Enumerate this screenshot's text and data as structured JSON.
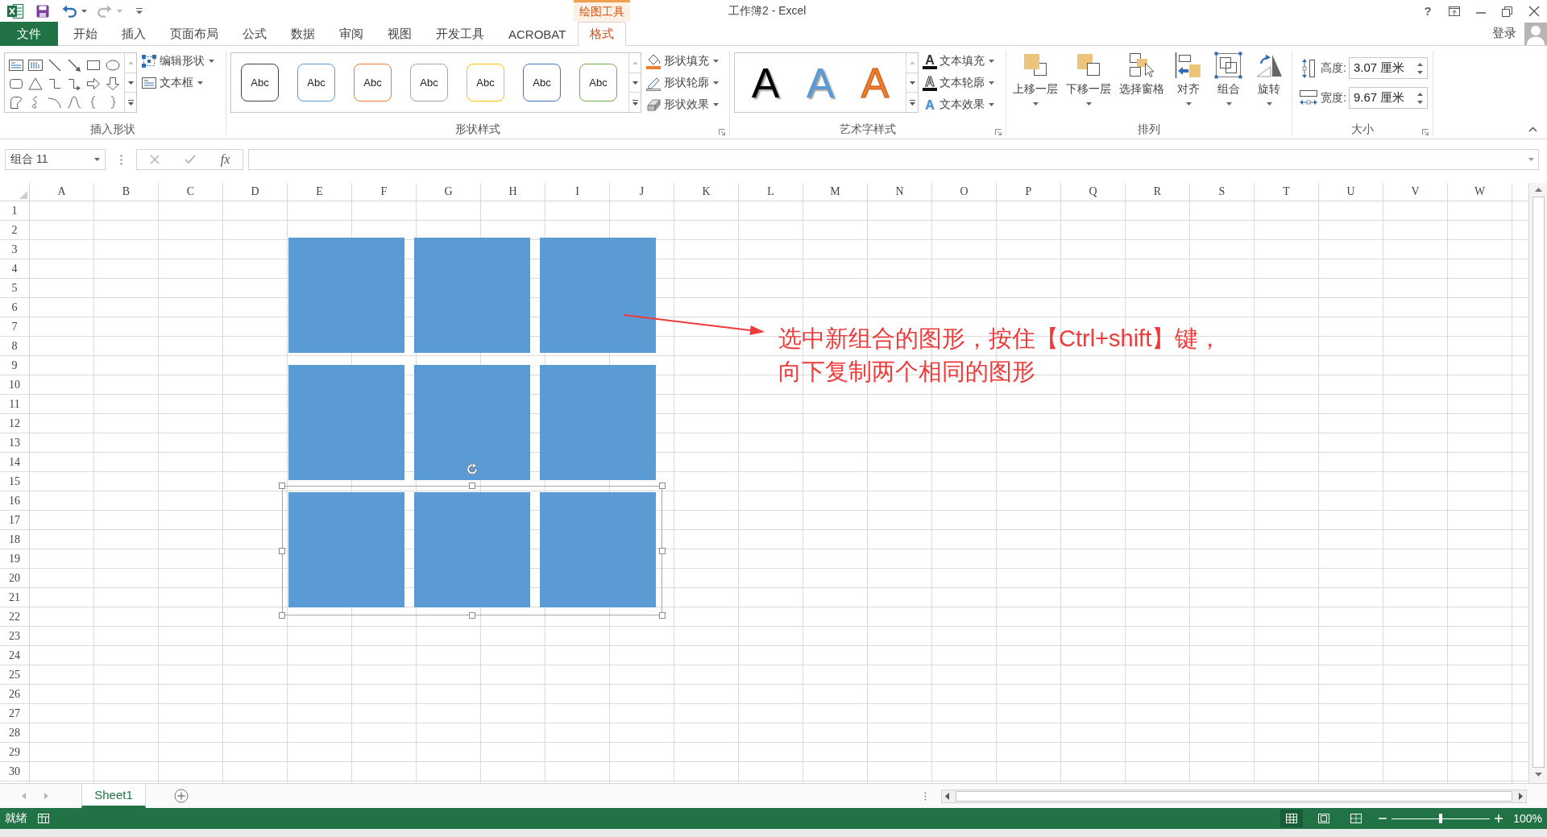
{
  "window": {
    "title": "工作簿2 - Excel",
    "help_button": "?"
  },
  "contextual_tab": {
    "label": "绘图工具"
  },
  "tabs": [
    {
      "label": "文件",
      "kind": "file",
      "selected": false
    },
    {
      "label": "开始",
      "kind": "tab",
      "selected": false
    },
    {
      "label": "插入",
      "kind": "tab",
      "selected": false
    },
    {
      "label": "页面布局",
      "kind": "tab",
      "selected": false
    },
    {
      "label": "公式",
      "kind": "tab",
      "selected": false
    },
    {
      "label": "数据",
      "kind": "tab",
      "selected": false
    },
    {
      "label": "审阅",
      "kind": "tab",
      "selected": false
    },
    {
      "label": "视图",
      "kind": "tab",
      "selected": false
    },
    {
      "label": "开发工具",
      "kind": "tab",
      "selected": false
    },
    {
      "label": "ACROBAT",
      "kind": "tab",
      "selected": false
    },
    {
      "label": "格式",
      "kind": "tab",
      "selected": true
    }
  ],
  "account": {
    "label": "登录"
  },
  "ribbon": {
    "groups": [
      {
        "kind": "insert_shapes",
        "label": "插入形状",
        "buttons": [
          {
            "label": "编辑形状",
            "dropdown": true
          },
          {
            "label": "文本框",
            "dropdown": true
          }
        ]
      },
      {
        "kind": "shape_styles",
        "label": "形状样式",
        "styles": [
          {
            "label": "Abc",
            "color": "#404040"
          },
          {
            "label": "Abc",
            "color": "#5b9bd5"
          },
          {
            "label": "Abc",
            "color": "#ed7d31"
          },
          {
            "label": "Abc",
            "color": "#a5a5a5"
          },
          {
            "label": "Abc",
            "color": "#ffc000"
          },
          {
            "label": "Abc",
            "color": "#4472c4"
          },
          {
            "label": "Abc",
            "color": "#70ad47"
          }
        ],
        "buttons": [
          {
            "label": "形状填充",
            "dropdown": true
          },
          {
            "label": "形状轮廓",
            "dropdown": true
          },
          {
            "label": "形状效果",
            "dropdown": true
          }
        ]
      },
      {
        "kind": "wordart_styles",
        "label": "艺术字样式",
        "styles": [
          {
            "label": "A",
            "kind": "solid",
            "color": "#000000"
          },
          {
            "label": "A",
            "kind": "solid",
            "color": "#5b9bd5"
          },
          {
            "label": "A",
            "kind": "outline",
            "color": "#ed7d31"
          }
        ],
        "buttons": [
          {
            "label": "文本填充",
            "glyph": "A",
            "kind": "fill",
            "dropdown": true
          },
          {
            "label": "文本轮廓",
            "glyph": "A",
            "kind": "outline",
            "dropdown": true
          },
          {
            "label": "文本效果",
            "glyph": "A",
            "kind": "effect",
            "dropdown": true
          }
        ]
      },
      {
        "kind": "arrange",
        "label": "排列",
        "buttons": [
          {
            "label": "上移一层",
            "dropdown": true
          },
          {
            "label": "下移一层",
            "dropdown": true
          },
          {
            "label": "选择窗格",
            "dropdown": false
          },
          {
            "label": "对齐",
            "dropdown": true
          },
          {
            "label": "组合",
            "dropdown": true
          },
          {
            "label": "旋转",
            "dropdown": true
          }
        ]
      },
      {
        "kind": "size",
        "label": "大小",
        "fields": [
          {
            "label": "高度:",
            "value": "3.07 厘米"
          },
          {
            "label": "宽度:",
            "value": "9.67 厘米"
          }
        ]
      }
    ]
  },
  "formula_bar": {
    "name_box": "组合 11",
    "function_button": "fx"
  },
  "sheet": {
    "columns": [
      "A",
      "B",
      "C",
      "D",
      "E",
      "F",
      "G",
      "H",
      "I",
      "J",
      "K",
      "L",
      "M",
      "N",
      "O",
      "P",
      "Q",
      "R",
      "S",
      "T",
      "U",
      "V",
      "W"
    ],
    "rows": [
      "1",
      "2",
      "3",
      "4",
      "5",
      "6",
      "7",
      "8",
      "9",
      "10",
      "11",
      "12",
      "13",
      "14",
      "15",
      "16",
      "17",
      "18",
      "19",
      "20",
      "21",
      "22",
      "23",
      "24",
      "25",
      "26",
      "27",
      "28",
      "29",
      "30"
    ]
  },
  "drawing": {
    "groups": [
      {
        "selected": false,
        "shapes": [
          {
            "kind": "rectangle"
          },
          {
            "kind": "rectangle"
          },
          {
            "kind": "rectangle"
          }
        ]
      },
      {
        "selected": false,
        "shapes": [
          {
            "kind": "rectangle"
          },
          {
            "kind": "rectangle"
          },
          {
            "kind": "rectangle"
          }
        ]
      },
      {
        "selected": true,
        "shapes": [
          {
            "kind": "rectangle"
          },
          {
            "kind": "rectangle"
          },
          {
            "kind": "rectangle"
          }
        ]
      }
    ]
  },
  "annotation": {
    "text": "选中新组合的图形，按住【Ctrl+shift】键，向下复制两个相同的图形"
  },
  "sheet_tabs": [
    {
      "label": "Sheet1",
      "selected": true
    }
  ],
  "status_bar": {
    "status": "就绪",
    "views": [
      {
        "kind": "normal",
        "selected": true
      },
      {
        "kind": "page_layout",
        "selected": false
      },
      {
        "kind": "page_break",
        "selected": false
      }
    ],
    "zoom": {
      "level": 0.5,
      "reading": "100%"
    }
  }
}
